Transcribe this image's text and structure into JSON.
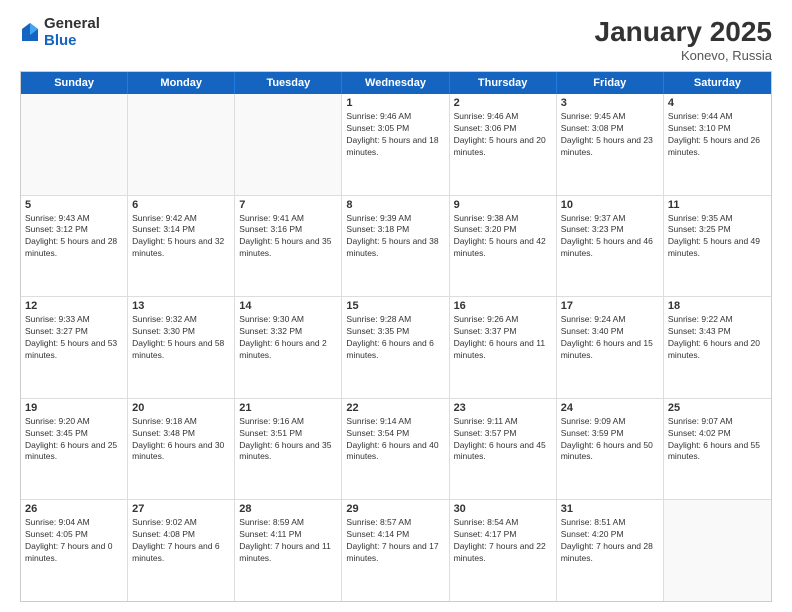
{
  "logo": {
    "general": "General",
    "blue": "Blue"
  },
  "title": "January 2025",
  "location": "Konevo, Russia",
  "weekdays": [
    "Sunday",
    "Monday",
    "Tuesday",
    "Wednesday",
    "Thursday",
    "Friday",
    "Saturday"
  ],
  "weeks": [
    [
      {
        "day": "",
        "empty": true
      },
      {
        "day": "",
        "empty": true
      },
      {
        "day": "",
        "empty": true
      },
      {
        "day": "1",
        "sunrise": "9:46 AM",
        "sunset": "3:05 PM",
        "daylight": "5 hours and 18 minutes."
      },
      {
        "day": "2",
        "sunrise": "9:46 AM",
        "sunset": "3:06 PM",
        "daylight": "5 hours and 20 minutes."
      },
      {
        "day": "3",
        "sunrise": "9:45 AM",
        "sunset": "3:08 PM",
        "daylight": "5 hours and 23 minutes."
      },
      {
        "day": "4",
        "sunrise": "9:44 AM",
        "sunset": "3:10 PM",
        "daylight": "5 hours and 26 minutes."
      }
    ],
    [
      {
        "day": "5",
        "sunrise": "9:43 AM",
        "sunset": "3:12 PM",
        "daylight": "5 hours and 28 minutes."
      },
      {
        "day": "6",
        "sunrise": "9:42 AM",
        "sunset": "3:14 PM",
        "daylight": "5 hours and 32 minutes."
      },
      {
        "day": "7",
        "sunrise": "9:41 AM",
        "sunset": "3:16 PM",
        "daylight": "5 hours and 35 minutes."
      },
      {
        "day": "8",
        "sunrise": "9:39 AM",
        "sunset": "3:18 PM",
        "daylight": "5 hours and 38 minutes."
      },
      {
        "day": "9",
        "sunrise": "9:38 AM",
        "sunset": "3:20 PM",
        "daylight": "5 hours and 42 minutes."
      },
      {
        "day": "10",
        "sunrise": "9:37 AM",
        "sunset": "3:23 PM",
        "daylight": "5 hours and 46 minutes."
      },
      {
        "day": "11",
        "sunrise": "9:35 AM",
        "sunset": "3:25 PM",
        "daylight": "5 hours and 49 minutes."
      }
    ],
    [
      {
        "day": "12",
        "sunrise": "9:33 AM",
        "sunset": "3:27 PM",
        "daylight": "5 hours and 53 minutes."
      },
      {
        "day": "13",
        "sunrise": "9:32 AM",
        "sunset": "3:30 PM",
        "daylight": "5 hours and 58 minutes."
      },
      {
        "day": "14",
        "sunrise": "9:30 AM",
        "sunset": "3:32 PM",
        "daylight": "6 hours and 2 minutes."
      },
      {
        "day": "15",
        "sunrise": "9:28 AM",
        "sunset": "3:35 PM",
        "daylight": "6 hours and 6 minutes."
      },
      {
        "day": "16",
        "sunrise": "9:26 AM",
        "sunset": "3:37 PM",
        "daylight": "6 hours and 11 minutes."
      },
      {
        "day": "17",
        "sunrise": "9:24 AM",
        "sunset": "3:40 PM",
        "daylight": "6 hours and 15 minutes."
      },
      {
        "day": "18",
        "sunrise": "9:22 AM",
        "sunset": "3:43 PM",
        "daylight": "6 hours and 20 minutes."
      }
    ],
    [
      {
        "day": "19",
        "sunrise": "9:20 AM",
        "sunset": "3:45 PM",
        "daylight": "6 hours and 25 minutes."
      },
      {
        "day": "20",
        "sunrise": "9:18 AM",
        "sunset": "3:48 PM",
        "daylight": "6 hours and 30 minutes."
      },
      {
        "day": "21",
        "sunrise": "9:16 AM",
        "sunset": "3:51 PM",
        "daylight": "6 hours and 35 minutes."
      },
      {
        "day": "22",
        "sunrise": "9:14 AM",
        "sunset": "3:54 PM",
        "daylight": "6 hours and 40 minutes."
      },
      {
        "day": "23",
        "sunrise": "9:11 AM",
        "sunset": "3:57 PM",
        "daylight": "6 hours and 45 minutes."
      },
      {
        "day": "24",
        "sunrise": "9:09 AM",
        "sunset": "3:59 PM",
        "daylight": "6 hours and 50 minutes."
      },
      {
        "day": "25",
        "sunrise": "9:07 AM",
        "sunset": "4:02 PM",
        "daylight": "6 hours and 55 minutes."
      }
    ],
    [
      {
        "day": "26",
        "sunrise": "9:04 AM",
        "sunset": "4:05 PM",
        "daylight": "7 hours and 0 minutes."
      },
      {
        "day": "27",
        "sunrise": "9:02 AM",
        "sunset": "4:08 PM",
        "daylight": "7 hours and 6 minutes."
      },
      {
        "day": "28",
        "sunrise": "8:59 AM",
        "sunset": "4:11 PM",
        "daylight": "7 hours and 11 minutes."
      },
      {
        "day": "29",
        "sunrise": "8:57 AM",
        "sunset": "4:14 PM",
        "daylight": "7 hours and 17 minutes."
      },
      {
        "day": "30",
        "sunrise": "8:54 AM",
        "sunset": "4:17 PM",
        "daylight": "7 hours and 22 minutes."
      },
      {
        "day": "31",
        "sunrise": "8:51 AM",
        "sunset": "4:20 PM",
        "daylight": "7 hours and 28 minutes."
      },
      {
        "day": "",
        "empty": true
      }
    ]
  ]
}
